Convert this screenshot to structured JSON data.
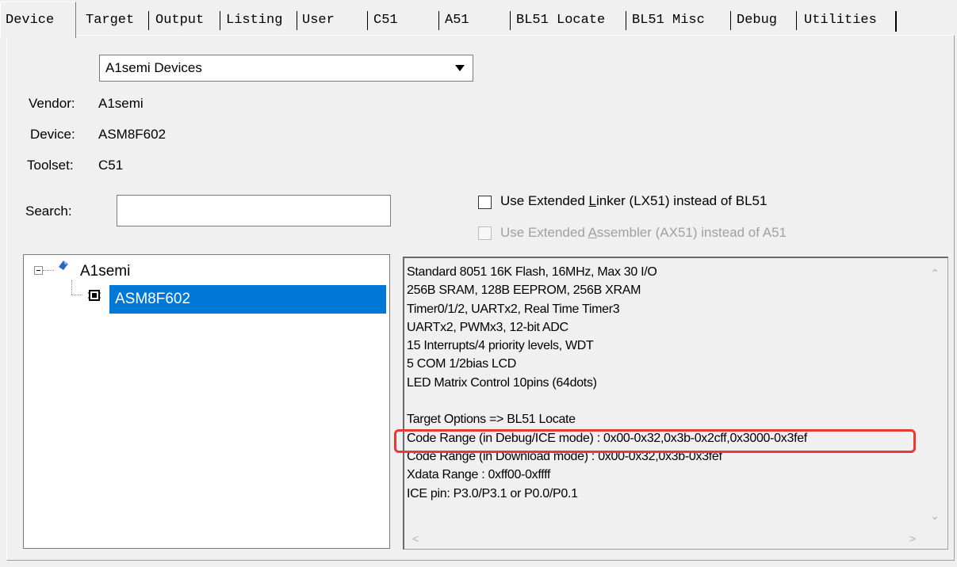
{
  "tabs": [
    {
      "label": "Device",
      "active": true
    },
    {
      "label": "Target"
    },
    {
      "label": "Output"
    },
    {
      "label": "Listing"
    },
    {
      "label": "User"
    },
    {
      "label": "C51"
    },
    {
      "label": "A51"
    },
    {
      "label": "BL51 Locate"
    },
    {
      "label": "BL51 Misc"
    },
    {
      "label": "Debug"
    },
    {
      "label": "Utilities"
    }
  ],
  "database": {
    "selected": "A1semi Devices",
    "icon": "dropdown-arrow-icon"
  },
  "info": {
    "vendor_label": "Vendor:",
    "vendor_value": "A1semi",
    "device_label": "Device:",
    "device_value": "ASM8F602",
    "toolset_label": "Toolset:",
    "toolset_value": "C51"
  },
  "search": {
    "label": "Search:",
    "value": ""
  },
  "options": {
    "lx51": {
      "label_pre": "Use Extended ",
      "label_key": "L",
      "label_post": "inker (LX51) instead of BL51",
      "checked": false,
      "enabled": true
    },
    "ax51": {
      "label_pre": "Use Extended ",
      "label_key": "A",
      "label_post": "ssembler (AX51) instead of A51",
      "checked": false,
      "enabled": false
    }
  },
  "tree": {
    "vendor": "A1semi",
    "device": "ASM8F602",
    "vendor_icon": "vendor-diamond-icon",
    "device_icon": "chip-icon",
    "selected_color": "#0078d7"
  },
  "description": {
    "lines": [
      "Standard 8051 16K Flash, 16MHz, Max 30 I/O",
      "256B SRAM, 128B EEPROM,  256B XRAM",
      "Timer0/1/2, UARTx2, Real Time Timer3",
      "UARTx2, PWMx3, 12-bit ADC",
      "15 Interrupts/4 priority levels, WDT",
      "5 COM 1/2bias LCD",
      "LED Matrix Control 10pins (64dots)",
      "",
      "Target Options => BL51 Locate",
      "Code Range (in Debug/ICE mode) : 0x00-0x32,0x3b-0x2cff,0x3000-0x3fef",
      "Code Range (in Download mode) : 0x00-0x32,0x3b-0x3fef",
      "Xdata Range : 0xff00-0xffff",
      "ICE pin: P3.0/P3.1 or P0.0/P0.1"
    ],
    "highlight_color": "#e83a2f"
  }
}
